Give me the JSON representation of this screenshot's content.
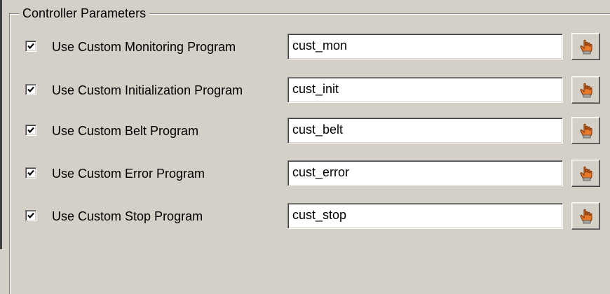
{
  "group": {
    "title": "Controller Parameters"
  },
  "rows": [
    {
      "checked": true,
      "label": "Use Custom Monitoring Program",
      "value": "cust_mon"
    },
    {
      "checked": true,
      "label": "Use Custom Initialization Program",
      "value": "cust_init"
    },
    {
      "checked": true,
      "label": "Use Custom Belt Program",
      "value": "cust_belt"
    },
    {
      "checked": true,
      "label": "Use Custom Error Program",
      "value": "cust_error"
    },
    {
      "checked": true,
      "label": "Use Custom Stop Program",
      "value": "cust_stop"
    }
  ],
  "icons": {
    "checkmark": "checkmark-icon",
    "browse": "pointing-hand-icon"
  },
  "colors": {
    "window_background": "#d4d0c8",
    "field_background": "#ffffff",
    "hand_icon": "#e8782a"
  }
}
